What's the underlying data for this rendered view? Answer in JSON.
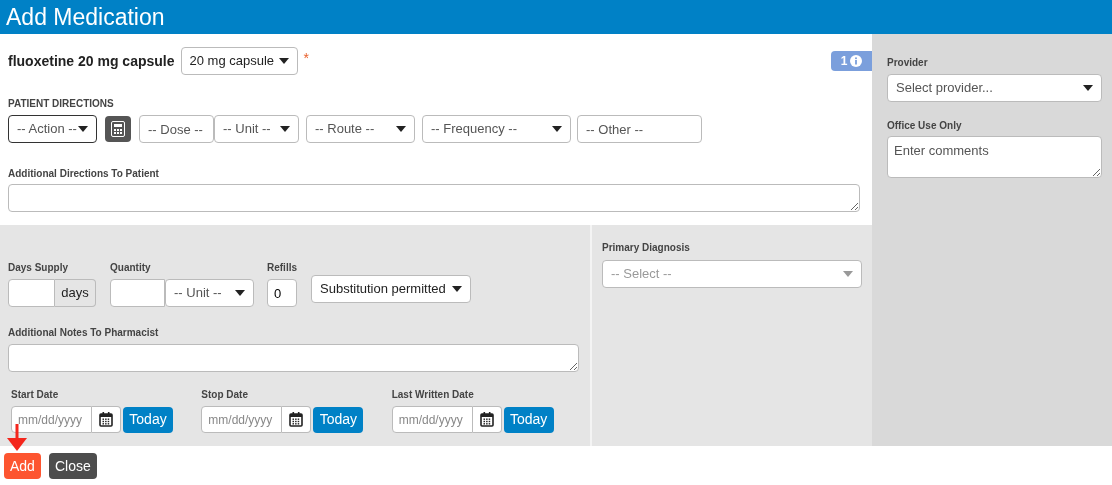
{
  "window": {
    "title": "Add Medication"
  },
  "medication": {
    "name": "fluoxetine 20 mg capsule",
    "strength": "20 mg capsule",
    "required_mark": "*",
    "badge": "1"
  },
  "patient_directions": {
    "heading": "PATIENT DIRECTIONS",
    "fields": [
      {
        "kind": "select",
        "placeholder": "-- Action --",
        "focused": true
      },
      {
        "kind": "calculator",
        "focused": false
      },
      {
        "kind": "input",
        "placeholder": "-- Dose --",
        "focused": false
      },
      {
        "kind": "select",
        "placeholder": "-- Unit --",
        "focused": false
      },
      {
        "kind": "select",
        "placeholder": "-- Route --",
        "focused": false
      },
      {
        "kind": "select",
        "placeholder": "-- Frequency --",
        "focused": false
      },
      {
        "kind": "input",
        "placeholder": "-- Other --",
        "focused": false
      }
    ]
  },
  "additional_directions": {
    "label": "Additional Directions To Patient"
  },
  "supply": {
    "days_label": "Days Supply",
    "days_unit": "days",
    "quantity_label": "Quantity",
    "quantity_unit": "-- Unit --",
    "refills_label": "Refills",
    "refills": "0",
    "substitution": "Substitution permitted"
  },
  "pharmacist_notes": {
    "label": "Additional Notes To Pharmacist"
  },
  "dates": [
    {
      "label": "Start Date",
      "placeholder": "mm/dd/yyyy",
      "today": "Today"
    },
    {
      "label": "Stop Date",
      "placeholder": "mm/dd/yyyy",
      "today": "Today"
    },
    {
      "label": "Last Written Date",
      "placeholder": "mm/dd/yyyy",
      "today": "Today"
    }
  ],
  "diagnosis": {
    "label": "Primary Diagnosis",
    "placeholder": "-- Select --"
  },
  "provider": {
    "label": "Provider",
    "placeholder": "Select provider..."
  },
  "office": {
    "label": "Office Use Only",
    "placeholder": "Enter comments"
  },
  "buttons": [
    {
      "kind": "primary",
      "label": "Add"
    },
    {
      "kind": "secondary",
      "label": "Close"
    }
  ]
}
